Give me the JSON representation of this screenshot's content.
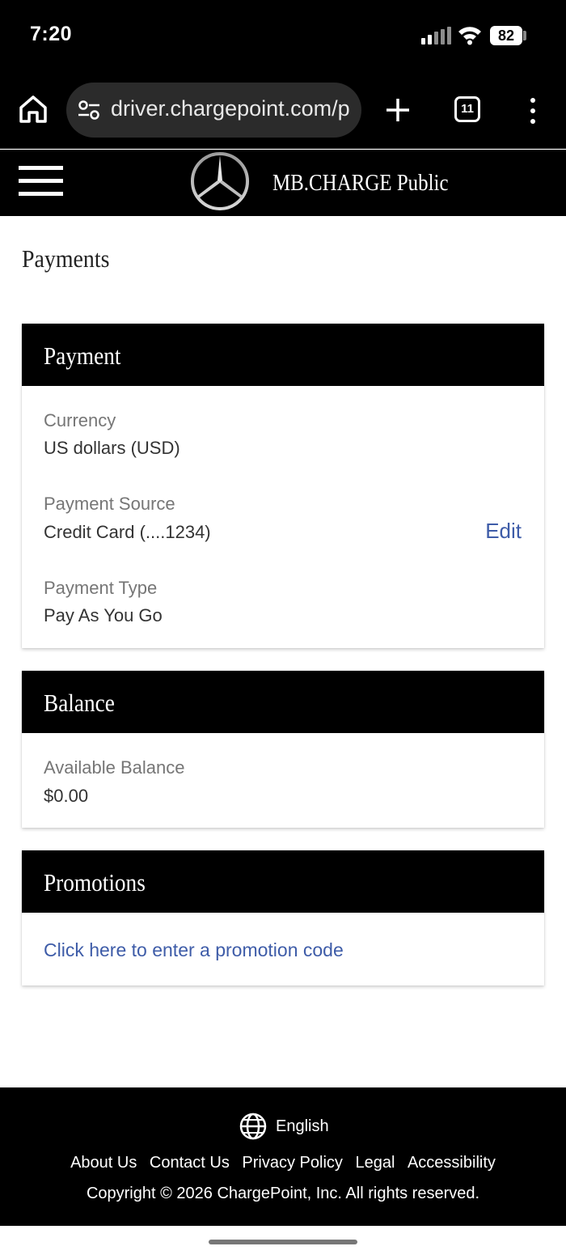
{
  "status_bar": {
    "time": "7:20",
    "battery": "82"
  },
  "browser": {
    "url": "driver.chargepoint.com/p",
    "tab_count": "11"
  },
  "header": {
    "brand": "MB.CHARGE Public"
  },
  "page": {
    "title": "Payments"
  },
  "payment_card": {
    "title": "Payment",
    "currency_label": "Currency",
    "currency_value": "US dollars (USD)",
    "source_label": "Payment Source",
    "source_value": "Credit Card (....1234)",
    "edit_label": "Edit",
    "type_label": "Payment Type",
    "type_value": "Pay As You Go"
  },
  "balance_card": {
    "title": "Balance",
    "available_label": "Available Balance",
    "available_value": "$0.00"
  },
  "promotions_card": {
    "title": "Promotions",
    "link_text": "Click here to enter a promotion code"
  },
  "footer": {
    "language": "English",
    "links": [
      "About Us",
      "Contact Us",
      "Privacy Policy",
      "Legal",
      "Accessibility"
    ],
    "copyright": "Copyright © 2026 ChargePoint, Inc. All rights reserved."
  },
  "colors": {
    "link": "#3e5ca8",
    "header_bg": "#000000"
  }
}
